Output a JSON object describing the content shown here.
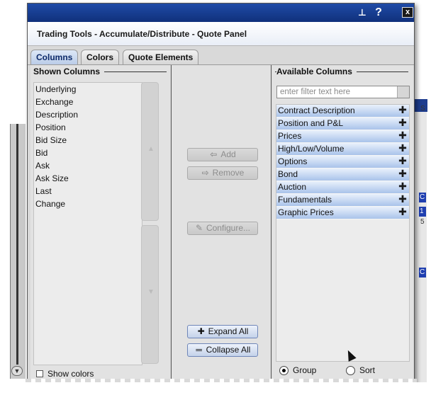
{
  "window": {
    "pin_icon": "pin-icon",
    "help_label": "?",
    "close_label": "x"
  },
  "header": {
    "title": "Trading Tools - Accumulate/Distribute - Quote Panel"
  },
  "tabs": [
    {
      "label": "Columns",
      "active": true
    },
    {
      "label": "Colors",
      "active": false
    },
    {
      "label": "Quote Elements",
      "active": false
    }
  ],
  "shown_columns": {
    "title": "Shown Columns",
    "items": [
      "Underlying",
      "Exchange",
      "Description",
      "Position",
      "Bid Size",
      "Bid",
      "Ask",
      "Ask Size",
      "Last",
      "Change"
    ],
    "show_colors_label": "Show colors"
  },
  "actions": {
    "add_label": "Add",
    "remove_label": "Remove",
    "configure_label": "Configure...",
    "expand_all_label": "Expand All",
    "collapse_all_label": "Collapse All"
  },
  "available_columns": {
    "title": "Available Columns",
    "filter_placeholder": "enter filter text here",
    "items": [
      "Contract Description",
      "Position and P&L",
      "Prices",
      "High/Low/Volume",
      "Options",
      "Bond",
      "Auction",
      "Fundamentals",
      "Graphic Prices"
    ],
    "group_label": "Group",
    "sort_label": "Sort",
    "group_selected": true
  },
  "colors": {
    "title_bar": "#10307b",
    "tab_active": "#b9cbe7",
    "item_gradient_end": "#a9c3ea",
    "panel_bg": "#e2e2e2"
  }
}
